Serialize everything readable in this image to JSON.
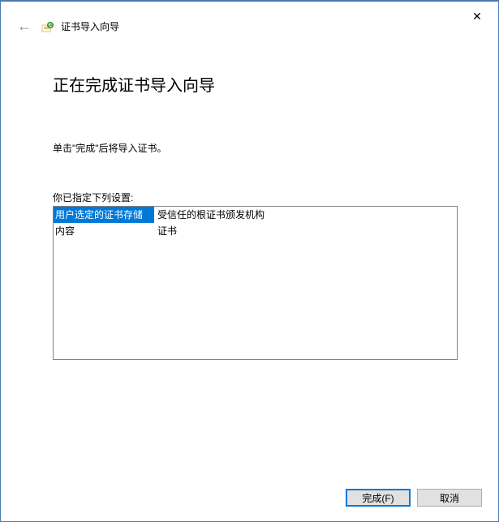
{
  "header": {
    "title": "证书导入向导"
  },
  "main": {
    "heading": "正在完成证书导入向导",
    "instruction": "单击\"完成\"后将导入证书。",
    "settings_label": "你已指定下列设置:",
    "settings": [
      {
        "key": "用户选定的证书存储",
        "value": "受信任的根证书颁发机构",
        "selected": true
      },
      {
        "key": "内容",
        "value": "证书",
        "selected": false
      }
    ]
  },
  "footer": {
    "finish_label": "完成(F)",
    "cancel_label": "取消"
  }
}
